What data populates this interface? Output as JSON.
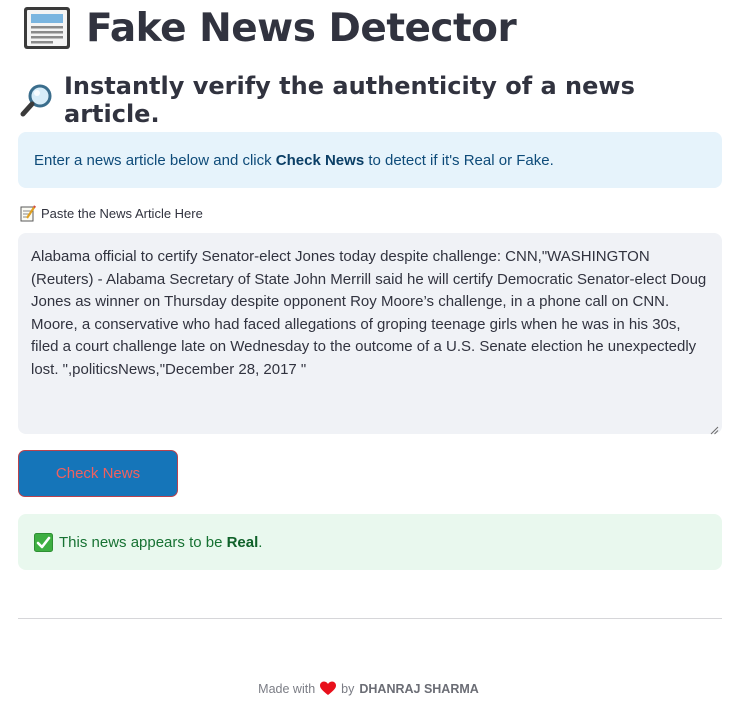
{
  "header": {
    "title": "Fake News Detector",
    "title_icon": "newspaper-icon"
  },
  "subheader": {
    "text": "Instantly verify the authenticity of a news article.",
    "icon": "magnifying-glass-icon"
  },
  "info": {
    "text_before": "Enter a news article below and click ",
    "bold": "Check News",
    "text_after": " to detect if it's Real or Fake."
  },
  "input": {
    "label": "Paste the News Article Here",
    "label_icon": "memo-icon",
    "value": "Alabama official to certify Senator-elect Jones today despite challenge: CNN,\"WASHINGTON (Reuters) - Alabama Secretary of State John Merrill said he will certify Democratic Senator-elect Doug Jones as winner on Thursday despite opponent Roy Moore’s challenge, in a phone call on CNN. Moore, a conservative who had faced allegations of groping teenage girls when he was in his 30s, filed a court challenge late on Wednesday to the outcome of a U.S. Senate election he unexpectedly lost. \",politicsNews,\"December 28, 2017 \""
  },
  "button": {
    "label": "Check News"
  },
  "result": {
    "icon": "check-mark-icon",
    "text_before": "This news appears to be ",
    "bold": "Real",
    "text_after": "."
  },
  "footer": {
    "made_with": "Made with",
    "heart_icon": "heart-icon",
    "by": "by",
    "author": "DHANRAJ SHARMA"
  },
  "colors": {
    "info_bg": "#e6f3fb",
    "success_bg": "#e9f8ee",
    "button_bg": "#1575b9",
    "button_text": "#f0605f",
    "textarea_bg": "#f0f2f6"
  }
}
